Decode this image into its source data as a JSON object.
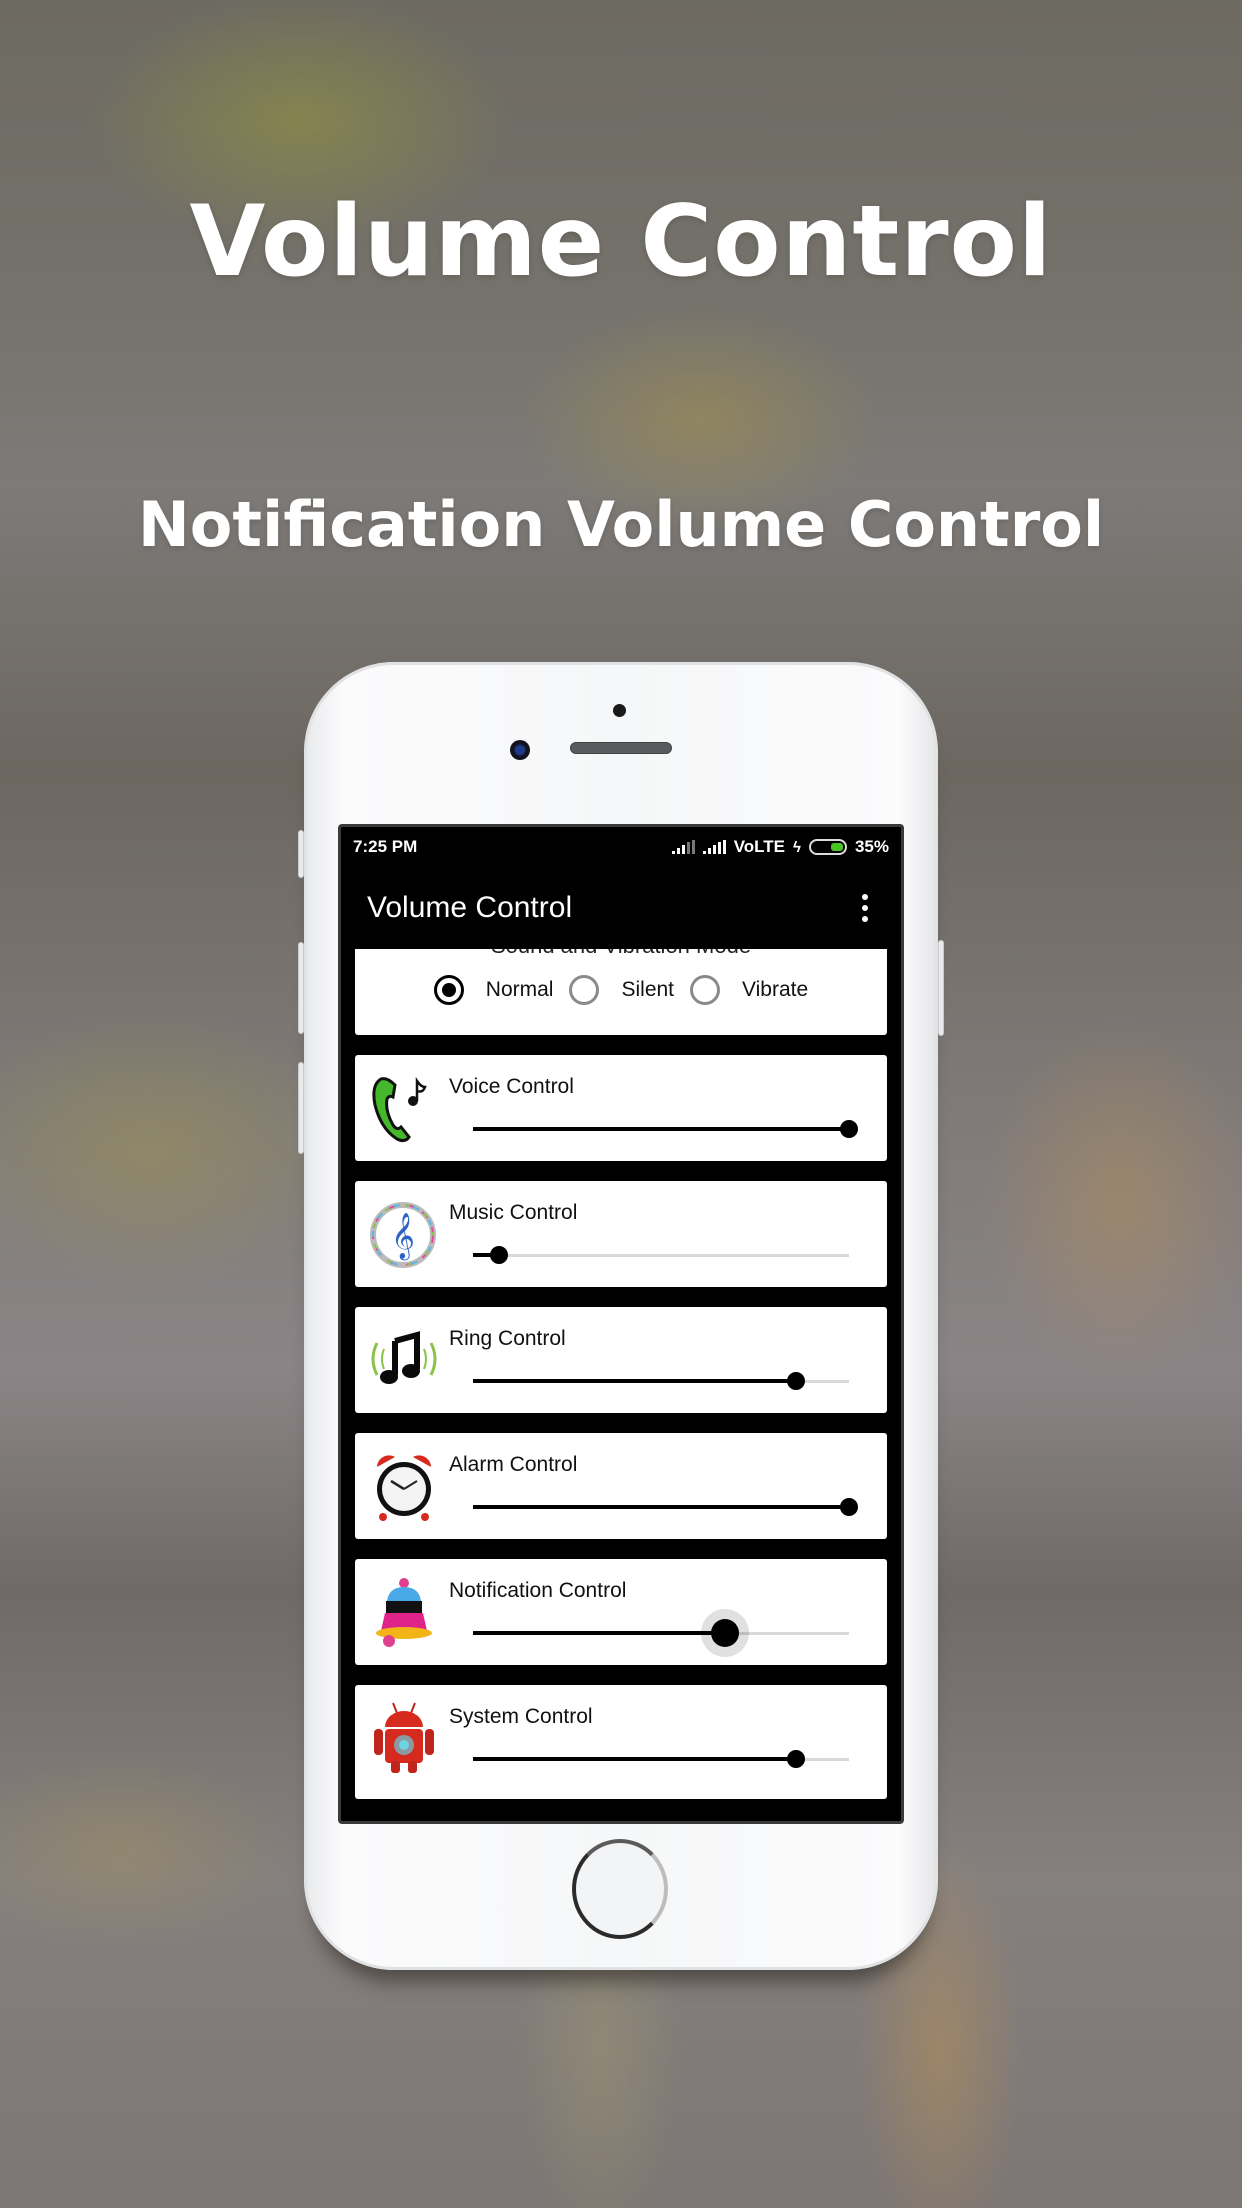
{
  "hero": {
    "title": "Volume Control",
    "subtitle": "Notification Volume Control"
  },
  "statusbar": {
    "time": "7:25 PM",
    "network": "VoLTE",
    "battery_percent": "35%",
    "battery_level": 0.35,
    "charging": true,
    "battery_color": "#4cc325"
  },
  "appbar": {
    "title": "Volume Control",
    "menu_icon": "more-vert-icon"
  },
  "mode": {
    "header": "Sound and Vibration Mode",
    "options": [
      {
        "label": "Normal",
        "checked": true
      },
      {
        "label": "Silent",
        "checked": false
      },
      {
        "label": "Vibrate",
        "checked": false
      }
    ]
  },
  "controls": [
    {
      "label": "Voice Control",
      "icon": "phone-music-icon",
      "value": 1.0
    },
    {
      "label": "Music Control",
      "icon": "treble-clef-icon",
      "value": 0.07
    },
    {
      "label": "Ring Control",
      "icon": "ringing-note-icon",
      "value": 0.86
    },
    {
      "label": "Alarm Control",
      "icon": "alarm-clock-icon",
      "value": 1.0
    },
    {
      "label": "Notification Control",
      "icon": "bell-icon",
      "value": 0.67,
      "active": true
    },
    {
      "label": "System Control",
      "icon": "android-settings-icon",
      "value": 0.86
    }
  ]
}
